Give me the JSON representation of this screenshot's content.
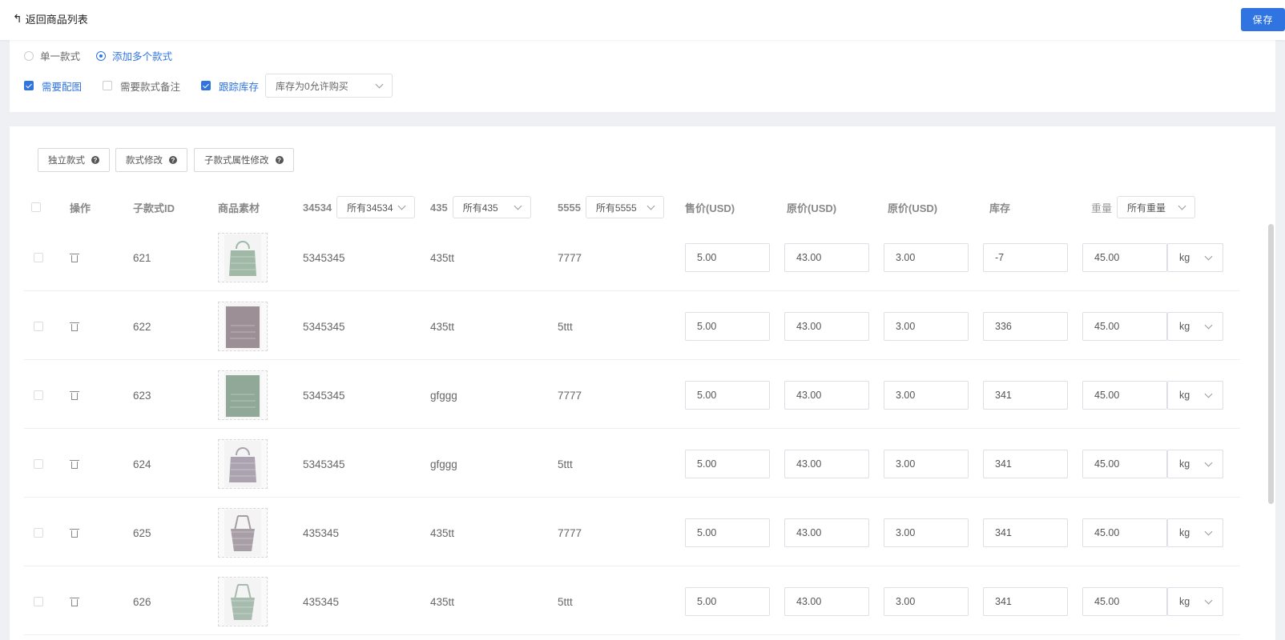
{
  "header": {
    "back_label": "返回商品列表",
    "save_label": "保存"
  },
  "style_mode": {
    "single": "单一款式",
    "multiple": "添加多个款式",
    "selected": "multiple"
  },
  "options": {
    "need_image": {
      "label": "需要配图",
      "checked": true
    },
    "need_note": {
      "label": "需要款式备注",
      "checked": false
    },
    "track_stock": {
      "label": "跟踪库存",
      "checked": true
    },
    "stock_policy": "库存为0允许购买"
  },
  "toolbar": {
    "independent": "独立款式",
    "edit": "款式修改",
    "sub_edit": "子款式属性修改"
  },
  "columns": {
    "action": "操作",
    "sub_id": "子款式ID",
    "material": "商品素材",
    "attr1": "34534",
    "attr1_filter": "所有34534",
    "attr2": "435",
    "attr2_filter": "所有435",
    "attr3": "5555",
    "attr3_filter": "所有5555",
    "price": "售价(USD)",
    "orig1": "原价(USD)",
    "orig2": "原价(USD)",
    "stock": "库存",
    "weight": "重量",
    "weight_filter": "所有重量"
  },
  "rows": [
    {
      "id": "621",
      "a1": "5345345",
      "a2": "435tt",
      "a3": "7777",
      "price": "5.00",
      "orig1": "43.00",
      "orig2": "3.00",
      "stock": "-7",
      "weight": "45.00",
      "unit": "kg",
      "img_color": "#9fb9a6",
      "img_style": "quilted-tote"
    },
    {
      "id": "622",
      "a1": "5345345",
      "a2": "435tt",
      "a3": "5ttt",
      "price": "5.00",
      "orig1": "43.00",
      "orig2": "3.00",
      "stock": "336",
      "weight": "45.00",
      "unit": "kg",
      "img_color": "#9c8f96",
      "img_style": "quilted-closeup"
    },
    {
      "id": "623",
      "a1": "5345345",
      "a2": "gfggg",
      "a3": "7777",
      "price": "5.00",
      "orig1": "43.00",
      "orig2": "3.00",
      "stock": "341",
      "weight": "45.00",
      "unit": "kg",
      "img_color": "#8fa898",
      "img_style": "quilted-closeup"
    },
    {
      "id": "624",
      "a1": "5345345",
      "a2": "gfggg",
      "a3": "5ttt",
      "price": "5.00",
      "orig1": "43.00",
      "orig2": "3.00",
      "stock": "341",
      "weight": "45.00",
      "unit": "kg",
      "img_color": "#aca3b0",
      "img_style": "quilted-tote"
    },
    {
      "id": "625",
      "a1": "435345",
      "a2": "435tt",
      "a3": "7777",
      "price": "5.00",
      "orig1": "43.00",
      "orig2": "3.00",
      "stock": "341",
      "weight": "45.00",
      "unit": "kg",
      "img_color": "#a89ea6",
      "img_style": "woven-tote"
    },
    {
      "id": "626",
      "a1": "435345",
      "a2": "435tt",
      "a3": "5ttt",
      "price": "5.00",
      "orig1": "43.00",
      "orig2": "3.00",
      "stock": "341",
      "weight": "45.00",
      "unit": "kg",
      "img_color": "#a7bcae",
      "img_style": "woven-tote"
    }
  ]
}
